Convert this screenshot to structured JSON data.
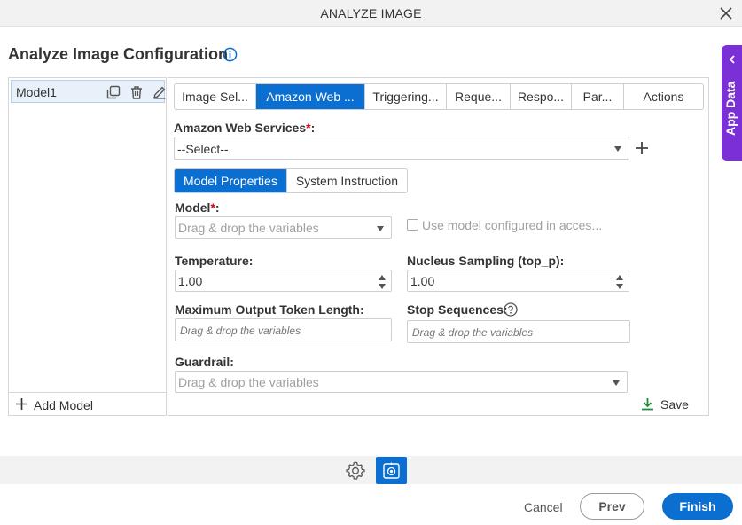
{
  "window": {
    "title": "ANALYZE IMAGE",
    "close_icon": "close-icon"
  },
  "page": {
    "heading": "Analyze Image Configuration",
    "info_icon": "info-icon"
  },
  "app_data_panel": {
    "label": "App Data",
    "icon": "chevron-left-icon",
    "color": "#7b2fd6"
  },
  "models": {
    "items": [
      {
        "name": "Model1",
        "selected": true
      }
    ],
    "actions": [
      "copy-icon",
      "trash-icon",
      "edit-icon"
    ],
    "add_label": "Add Model"
  },
  "tabs": [
    {
      "label": "Image Sel...",
      "active": false
    },
    {
      "label": "Amazon Web ...",
      "active": true
    },
    {
      "label": "Triggering...",
      "active": false
    },
    {
      "label": "Reque...",
      "active": false
    },
    {
      "label": "Respo...",
      "active": false
    },
    {
      "label": "Par...",
      "active": false
    },
    {
      "label": "Actions",
      "active": false
    }
  ],
  "form": {
    "aws_label": "Amazon Web Services",
    "aws_required_mark": "*",
    "aws_colon": ":",
    "aws_value": "--Select--",
    "subtabs": [
      {
        "label": "Model Properties",
        "active": true
      },
      {
        "label": "System Instruction",
        "active": false
      }
    ],
    "model_label": "Model",
    "model_required_mark": "*",
    "model_colon": ":",
    "model_placeholder": "Drag & drop the variables",
    "use_model_checkbox_label": "Use model configured in acces...",
    "use_model_checked": false,
    "temperature_label": "Temperature:",
    "temperature_value": "1.00",
    "top_p_label": "Nucleus Sampling (top_p):",
    "top_p_value": "1.00",
    "max_tokens_label": "Maximum Output Token Length:",
    "max_tokens_placeholder": "Drag & drop the variables",
    "stop_sequences_label": "Stop Sequences:",
    "stop_sequences_placeholder": "Drag & drop the variables",
    "guardrail_label": "Guardrail:",
    "guardrail_placeholder": "Drag & drop the variables",
    "save_label": "Save"
  },
  "toolbar": {
    "icons": [
      "gear-icon",
      "analyze-image-icon"
    ]
  },
  "footer": {
    "cancel_label": "Cancel",
    "prev_label": "Prev",
    "finish_label": "Finish"
  },
  "colors": {
    "accent": "#0a6fd1",
    "required": "#d0021b",
    "save_icon": "#1f8a3b"
  }
}
